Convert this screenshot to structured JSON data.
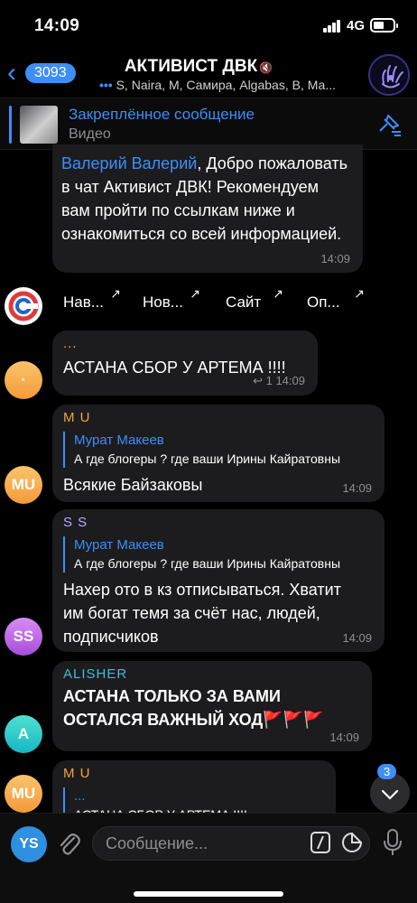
{
  "status": {
    "time": "14:09",
    "network": "4G"
  },
  "header": {
    "back_count": "3093",
    "title": "АКТИВИСТ ДВК",
    "members": "S, Naira, M, Самира, Algabas, B, Ма...",
    "mute_icon": "mute-icon"
  },
  "pinned": {
    "title": "Закреплённое сообщение",
    "subtitle": "Видео"
  },
  "messages": {
    "welcome": {
      "mention": "Валерий Валерий",
      "text": ", Добро пожаловать в чат Активист ДВК! Рекомендуем вам пройти по ссылкам ниже и ознакомиться со всей информацией.",
      "time": "14:09"
    },
    "buttons": [
      "Нав...",
      "Нов...",
      "Сайт",
      "Оп..."
    ],
    "m1": {
      "author": "...",
      "text": "АСТАНА СБОР У АРТЕМА !!!!",
      "replies": "1",
      "time": "14:09"
    },
    "m2": {
      "avatar": "MU",
      "author": "M U",
      "reply_name": "Мурат Макеев",
      "reply_text": "А где блогеры ? где ваши Ирины Кайратовны",
      "text": "Всякие Байзаковы",
      "time": "14:09"
    },
    "m3": {
      "avatar": "SS",
      "author": "S S",
      "reply_name": "Мурат Макеев",
      "reply_text": "А где блогеры ? где ваши Ирины Кайратовны",
      "text": "Нахер ото в кз отписываться. Хватит им богат темя за счёт нас, людей, подписчиков",
      "time": "14:09"
    },
    "m4": {
      "avatar": "A",
      "author": "ALISHER",
      "text": "АСТАНА ТОЛЬКО ЗА ВАМИ ОСТАЛСЯ ВАЖНЫЙ ХОД",
      "flags": "🚩🚩🚩",
      "time": "14:09"
    },
    "m5": {
      "avatar": "MU",
      "author": "M U",
      "reply_name": "...",
      "reply_text": "АСТАНА СБОР У АРТЕМА !!!!"
    }
  },
  "scroll_badge": "3",
  "input": {
    "avatar": "YS",
    "placeholder": "Сообщение..."
  },
  "colors": {
    "accent": "#3e8ef7",
    "bubble": "#1c1c1e",
    "orange": "#f3a33c",
    "purple": "#b85fe0",
    "teal": "#22c7c7"
  }
}
